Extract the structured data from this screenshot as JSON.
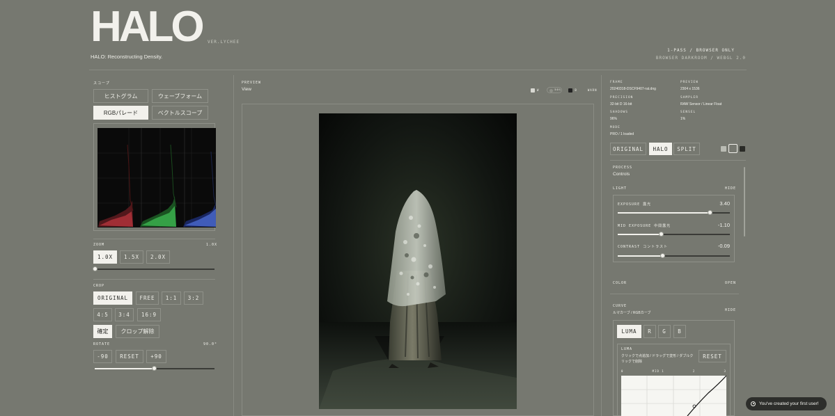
{
  "header": {
    "logo": "HALO",
    "version": "VER.LYCHEE",
    "tagline": "HALO: Reconstructing Density.",
    "mode_line1": "1-PASS / BROWSER ONLY",
    "mode_line2": "BROWSER DARKROOM / WEBGL 2.0"
  },
  "scope": {
    "title": "スコープ",
    "buttons": [
      "ヒストグラム",
      "ウェーブフォーム",
      "RGBパレード",
      "ベクトルスコープ"
    ],
    "active": "RGBパレード"
  },
  "zoom": {
    "title": "ZOOM",
    "value": "1.0X",
    "options": [
      "1.0X",
      "1.5X",
      "2.0X"
    ],
    "level": 0.0
  },
  "crop": {
    "title": "CROP",
    "options": [
      "ORIGINAL",
      "FREE",
      "1:1",
      "3:2",
      "4:5",
      "3:4",
      "16:9"
    ],
    "confirm": "確定",
    "reset": "クロップ解除"
  },
  "rotate": {
    "title": "ROTATE",
    "value": "90.0°",
    "minus": "-90",
    "reset": "RESET",
    "plus": "+90",
    "level": 0.5
  },
  "preview": {
    "label": "PREVIEW",
    "title": "View",
    "swatch1": "W",
    "swatch2": "50%",
    "swatch3": "B",
    "swatch4": "WARN"
  },
  "meta": {
    "frame_k": "FRAME",
    "frame_v": "20240318-DSCF9407-rat.dng",
    "preview_k": "PREVIEW",
    "preview_v": "2304 x 1536",
    "precision_k": "PRECISION",
    "precision_v": "32-bit D 16-bit",
    "sampler_k": "SAMPLER",
    "sampler_v": "RAW Sensor / Linear Float",
    "shadows_k": "SHADOWS",
    "shadows_v": "96%",
    "sensel_k": "SENSEL",
    "sensel_v": "1%",
    "mode_k": "MODE",
    "mode_v": "PRO / 1 loaded"
  },
  "view_modes": [
    "ORIGINAL",
    "HALO",
    "SPLIT"
  ],
  "view_active": "HALO",
  "process": {
    "label": "PROCESS",
    "title": "Controls"
  },
  "light": {
    "title": "LIGHT",
    "toggle": "HIDE",
    "controls": [
      {
        "label": "EXPOSURE 露光",
        "value": "3.40",
        "level": 0.87
      },
      {
        "label": "MID EXPOSURE 中間露光",
        "value": "-1.10",
        "level": 0.42
      },
      {
        "label": "CONTRAST コントラスト",
        "value": "-0.09",
        "level": 0.43
      }
    ]
  },
  "color": {
    "title": "COLOR",
    "toggle": "OPEN"
  },
  "curve": {
    "title": "CURVE",
    "subtitle": "ルマカーブ / RGBカーブ",
    "toggle": "HIDE",
    "channels": [
      "LUMA",
      "R",
      "G",
      "B"
    ],
    "active": "LUMA",
    "luma_label": "LUMA",
    "hint": "クリックで点追加 / ドラッグで変形 / ダブルクリックで削除",
    "reset": "RESET",
    "axis": [
      "0",
      "MID 1",
      "2",
      "3"
    ]
  },
  "toast": {
    "text": "You've created your first user!"
  },
  "colors": {
    "background": "#767870",
    "panel_text": "#f2f1ec",
    "active_button": "#f2f1ec"
  }
}
